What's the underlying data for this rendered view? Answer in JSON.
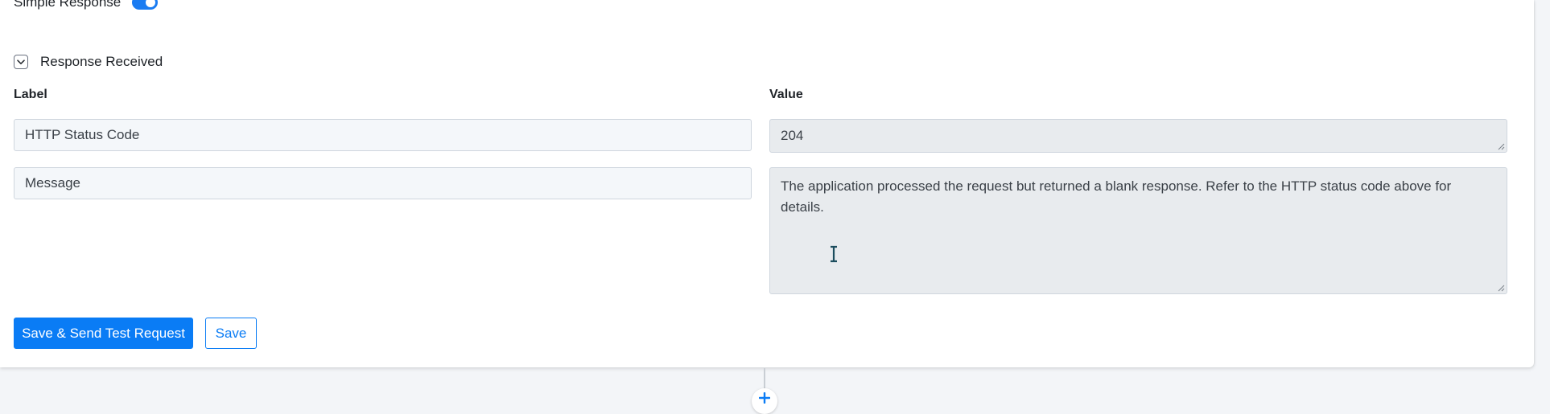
{
  "simple_response": {
    "label": "Simple Response",
    "toggle_on": true
  },
  "section": {
    "title": "Response Received",
    "expanded": true
  },
  "columns": {
    "label_header": "Label",
    "value_header": "Value"
  },
  "rows": [
    {
      "label": "HTTP Status Code",
      "value": "204"
    },
    {
      "label": "Message",
      "value": "The application processed the request but returned a blank response.  Refer to the HTTP status code above for details."
    }
  ],
  "buttons": {
    "save_send": "Save & Send Test Request",
    "save": "Save"
  },
  "colors": {
    "accent": "#0a7cf5",
    "toggle": "#1a7cf2",
    "input_bg": "#f4f7fa",
    "readonly_bg": "#e8ebee"
  },
  "icons": {
    "toggle": "toggle-switch",
    "section": "chevron-down-icon",
    "add": "plus-icon"
  }
}
